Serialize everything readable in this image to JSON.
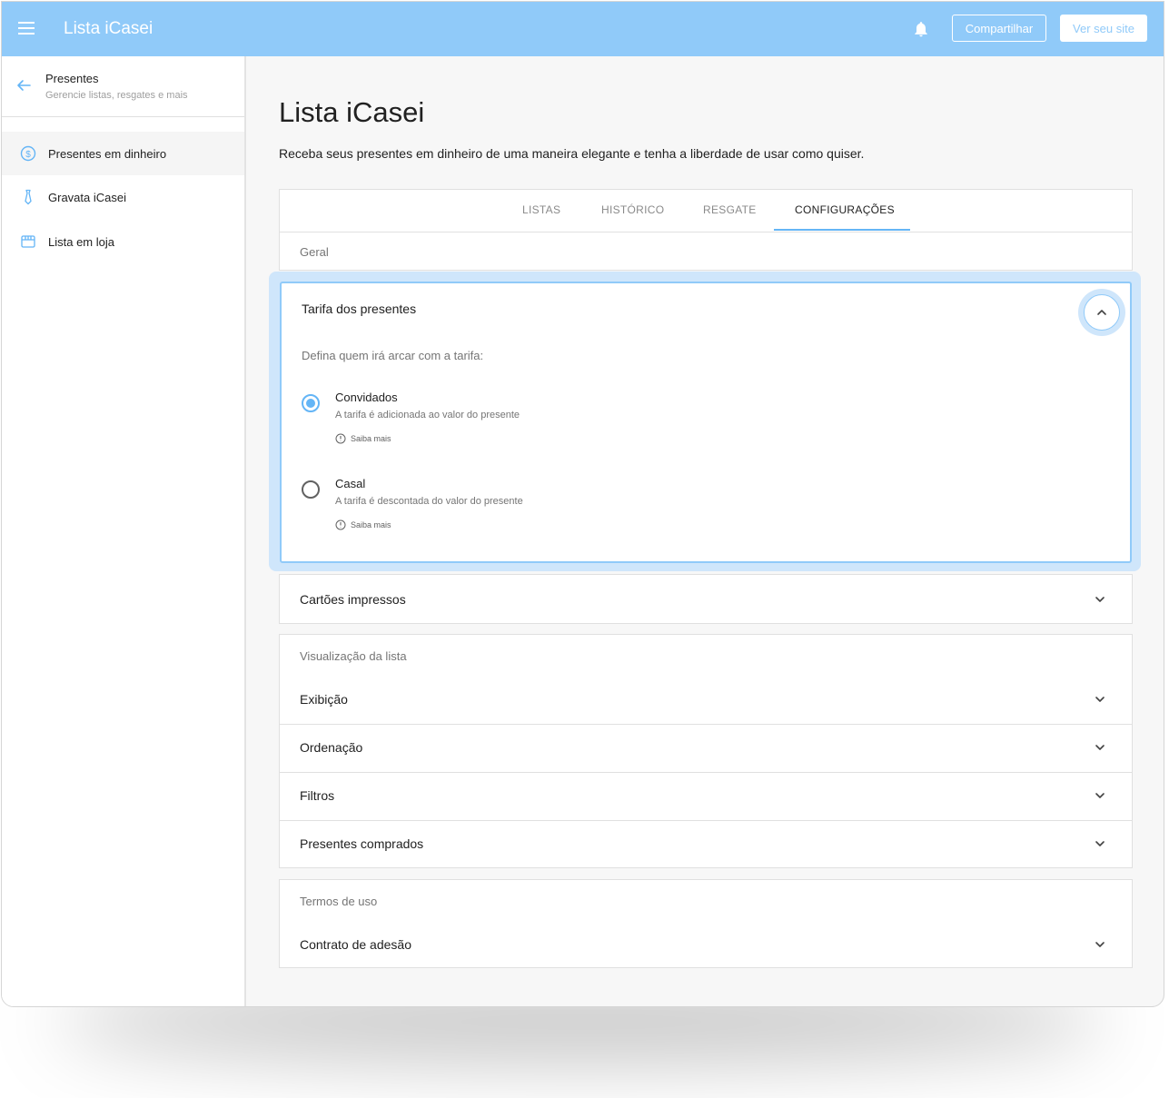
{
  "appbar": {
    "title": "Lista iCasei",
    "share_label": "Compartilhar",
    "view_site_label": "Ver seu site",
    "accent_color": "#90caf9"
  },
  "sidebar": {
    "back_title": "Presentes",
    "back_subtitle": "Gerencie listas, resgates e mais",
    "items": [
      {
        "label": "Presentes em dinheiro",
        "icon": "dollar-circle-icon",
        "active": true
      },
      {
        "label": "Gravata iCasei",
        "icon": "tie-icon",
        "active": false
      },
      {
        "label": "Lista em loja",
        "icon": "store-icon",
        "active": false
      }
    ]
  },
  "main": {
    "title": "Lista iCasei",
    "description": "Receba seus presentes em dinheiro de uma maneira elegante e tenha a liberdade de usar como quiser.",
    "tabs": [
      {
        "label": "LISTAS",
        "active": false
      },
      {
        "label": "HISTÓRICO",
        "active": false
      },
      {
        "label": "RESGATE",
        "active": false
      },
      {
        "label": "CONFIGURAÇÕES",
        "active": true
      }
    ],
    "general_label": "Geral",
    "fee_section": {
      "title": "Tarifa dos presentes",
      "hint": "Defina quem irá arcar com a tarifa:",
      "options": [
        {
          "title": "Convidados",
          "description": "A tarifa é adicionada ao valor do presente",
          "more": "Saiba mais",
          "selected": true
        },
        {
          "title": "Casal",
          "description": "A tarifa é descontada do valor do presente",
          "more": "Saiba mais",
          "selected": false
        }
      ]
    },
    "printed_cards": "Cartões impressos",
    "list_view": {
      "label": "Visualização da lista",
      "items": [
        "Exibição",
        "Ordenação",
        "Filtros",
        "Presentes comprados"
      ]
    },
    "terms": {
      "label": "Termos de uso",
      "items": [
        "Contrato de adesão"
      ]
    }
  }
}
